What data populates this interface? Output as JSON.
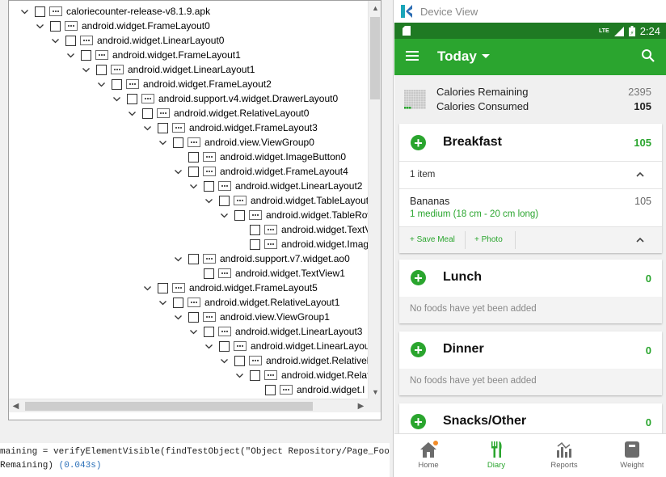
{
  "tree": {
    "nodes": [
      {
        "label": "caloriecounter-release-v8.1.9.apk",
        "depth": 0,
        "expander": "open"
      },
      {
        "label": "android.widget.FrameLayout0",
        "depth": 1,
        "expander": "open"
      },
      {
        "label": "android.widget.LinearLayout0",
        "depth": 2,
        "expander": "open"
      },
      {
        "label": "android.widget.FrameLayout1",
        "depth": 3,
        "expander": "open"
      },
      {
        "label": "android.widget.LinearLayout1",
        "depth": 4,
        "expander": "open"
      },
      {
        "label": "android.widget.FrameLayout2",
        "depth": 5,
        "expander": "open"
      },
      {
        "label": "android.support.v4.widget.DrawerLayout0",
        "depth": 6,
        "expander": "open"
      },
      {
        "label": "android.widget.RelativeLayout0",
        "depth": 7,
        "expander": "open"
      },
      {
        "label": "android.widget.FrameLayout3",
        "depth": 8,
        "expander": "open"
      },
      {
        "label": "android.view.ViewGroup0",
        "depth": 9,
        "expander": "open"
      },
      {
        "label": "android.widget.ImageButton0",
        "depth": 10,
        "expander": "none"
      },
      {
        "label": "android.widget.FrameLayout4",
        "depth": 10,
        "expander": "open"
      },
      {
        "label": "android.widget.LinearLayout2",
        "depth": 11,
        "expander": "open"
      },
      {
        "label": "android.widget.TableLayout",
        "depth": 12,
        "expander": "open"
      },
      {
        "label": "android.widget.TableRow",
        "depth": 13,
        "expander": "open"
      },
      {
        "label": "android.widget.TextV",
        "depth": 14,
        "expander": "none"
      },
      {
        "label": "android.widget.Imag",
        "depth": 14,
        "expander": "none"
      },
      {
        "label": "android.support.v7.widget.ao0",
        "depth": 10,
        "expander": "open"
      },
      {
        "label": "android.widget.TextView1",
        "depth": 11,
        "expander": "none"
      },
      {
        "label": "android.widget.FrameLayout5",
        "depth": 8,
        "expander": "open"
      },
      {
        "label": "android.widget.RelativeLayout1",
        "depth": 9,
        "expander": "open"
      },
      {
        "label": "android.view.ViewGroup1",
        "depth": 10,
        "expander": "open"
      },
      {
        "label": "android.widget.LinearLayout3",
        "depth": 11,
        "expander": "open"
      },
      {
        "label": "android.widget.LinearLayou",
        "depth": 12,
        "expander": "open"
      },
      {
        "label": "android.widget.Relativel",
        "depth": 13,
        "expander": "open"
      },
      {
        "label": "android.widget.Relat",
        "depth": 14,
        "expander": "open"
      },
      {
        "label": "android.widget.l",
        "depth": 15,
        "expander": "none"
      }
    ]
  },
  "log": {
    "line1": "maining = verifyElementVisible(findTestObject(\"Object Repository/Page_FoodDiary/txt_Calor",
    "line2": "Remaining)",
    "time": "(0.043s)"
  },
  "device": {
    "window_title": "Device View",
    "status": {
      "time": "2:24",
      "network": "LTE"
    },
    "appbar": {
      "title": "Today"
    },
    "summary": {
      "remaining_label": "Calories Remaining",
      "remaining_value": "2395",
      "consumed_label": "Calories Consumed",
      "consumed_value": "105"
    },
    "breakfast": {
      "name": "Breakfast",
      "calories": "105",
      "item_count": "1 item",
      "food": "Bananas",
      "food_cal": "105",
      "serving": "1  medium (18 cm - 20 cm long)",
      "save_meal": "+ Save Meal",
      "photo": "+ Photo"
    },
    "lunch": {
      "name": "Lunch",
      "calories": "0",
      "empty": "No foods have yet been added"
    },
    "dinner": {
      "name": "Dinner",
      "calories": "0",
      "empty": "No foods have yet been added"
    },
    "snacks": {
      "name": "Snacks/Other",
      "calories": "0"
    },
    "nav": {
      "home": "Home",
      "diary": "Diary",
      "reports": "Reports",
      "weight": "Weight"
    },
    "colors": {
      "primary": "#2ba52f",
      "dark": "#1f7a23",
      "accent": "#2aa52e",
      "badge": "#f28c28"
    }
  }
}
